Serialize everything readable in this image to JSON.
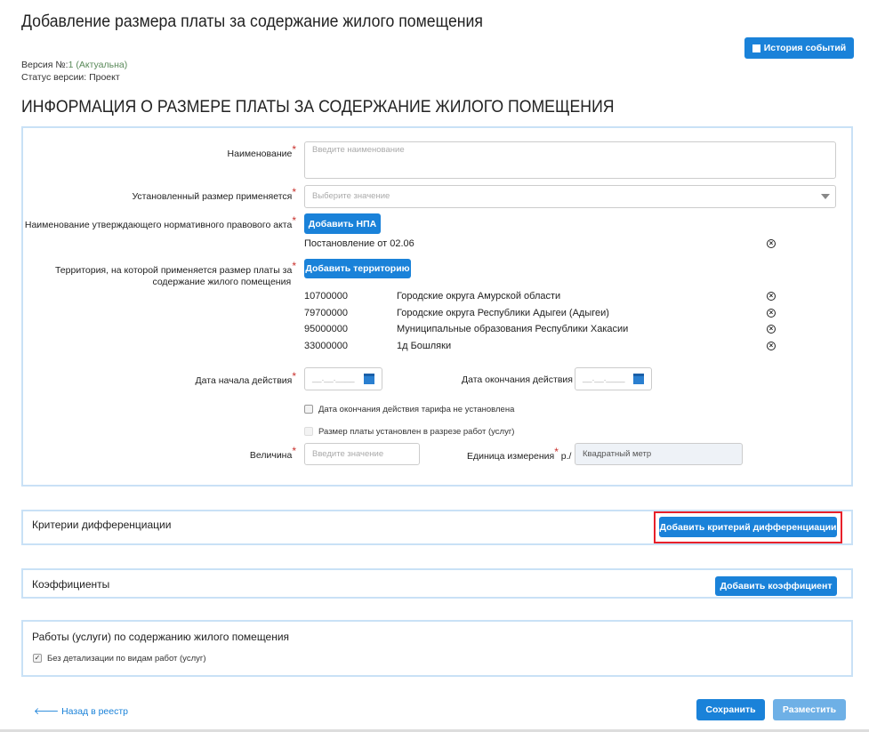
{
  "header": {
    "title": "Добавление размера платы за содержание жилого помещения",
    "history_button": "История событий",
    "version_label": "Версия №:",
    "version_number": "1",
    "version_state": "(Актуальна)",
    "status": "Статус версии: Проект",
    "section_title": "ИНФОРМАЦИЯ О РАЗМЕРЕ ПЛАТЫ ЗА СОДЕРЖАНИЕ ЖИЛОГО ПОМЕЩЕНИЯ"
  },
  "form": {
    "name_label": "Наименование",
    "name_placeholder": "Введите наименование",
    "applies_label": "Установленный размер применяется",
    "applies_placeholder": "Выберите значение",
    "npa_label": "Наименование утверждающего нормативного правового акта",
    "npa_button": "Добавить НПА",
    "npa_items": [
      "Постановление от 02.06"
    ],
    "territory_label_1": "Территория, на которой применяется размер платы за",
    "territory_label_2": "содержание жилого помещения",
    "territory_button": "Добавить территорию",
    "territories": [
      {
        "code": "10700000",
        "name": "Городские округа Амурской области"
      },
      {
        "code": "79700000",
        "name": "Городские округа Республики Адыгеи (Адыгеи)"
      },
      {
        "code": "95000000",
        "name": "Муниципальные образования Республики Хакасии"
      },
      {
        "code": "33000000",
        "name": "1д Бошляки"
      }
    ],
    "start_label": "Дата начала действия",
    "end_label": "Дата окончания действия",
    "date_placeholder": "__.__.____",
    "no_end_checkbox": "Дата окончания действия тарифа не установлена",
    "by_works_checkbox": "Размер платы установлен в разрезе работ (услуг)",
    "value_label": "Величина",
    "value_placeholder": "Введите значение",
    "unit_label": "Единица измерения",
    "unit_suffix": "р./",
    "unit_value": "Квадратный метр",
    "required_mark": "*"
  },
  "criteria": {
    "title": "Критерии дифференциации",
    "button": "Добавить критерий дифференциации"
  },
  "coefficients": {
    "title": "Коэффициенты",
    "button": "Добавить коэффициент"
  },
  "works": {
    "title": "Работы (услуги) по содержанию жилого помещения",
    "checkbox": "Без детализации по видам работ (услуг)",
    "checked": true
  },
  "footer": {
    "back": "Назад в реестр",
    "save": "Сохранить",
    "publish": "Разместить"
  },
  "colors": {
    "primary": "#1a82d9",
    "panel_border": "#c9e1f6",
    "highlight": "#e8202a"
  }
}
